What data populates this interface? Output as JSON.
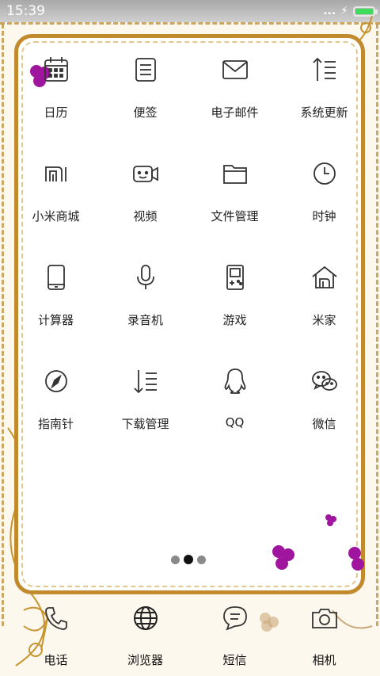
{
  "status_bar": {
    "time": "15:39",
    "signal_dots": "...",
    "charging_symbol": "⚡",
    "battery_color": "#3ddc5a"
  },
  "apps": [
    {
      "label": "日历",
      "icon": "calendar-icon"
    },
    {
      "label": "便签",
      "icon": "notes-icon"
    },
    {
      "label": "电子邮件",
      "icon": "mail-icon"
    },
    {
      "label": "系统更新",
      "icon": "system-update-icon"
    },
    {
      "label": "小米商城",
      "icon": "mi-store-icon"
    },
    {
      "label": "视频",
      "icon": "video-icon"
    },
    {
      "label": "文件管理",
      "icon": "folder-icon"
    },
    {
      "label": "时钟",
      "icon": "clock-icon"
    },
    {
      "label": "计算器",
      "icon": "calculator-icon"
    },
    {
      "label": "录音机",
      "icon": "microphone-icon"
    },
    {
      "label": "游戏",
      "icon": "game-icon"
    },
    {
      "label": "米家",
      "icon": "smart-home-icon"
    },
    {
      "label": "指南针",
      "icon": "compass-icon"
    },
    {
      "label": "下载管理",
      "icon": "download-icon"
    },
    {
      "label": "QQ",
      "icon": "qq-icon"
    },
    {
      "label": "微信",
      "icon": "wechat-icon"
    }
  ],
  "page_indicator": {
    "pages": 3,
    "active_index": 1
  },
  "dock": [
    {
      "label": "电话",
      "icon": "phone-icon"
    },
    {
      "label": "浏览器",
      "icon": "browser-icon"
    },
    {
      "label": "短信",
      "icon": "sms-icon"
    },
    {
      "label": "相机",
      "icon": "camera-icon"
    }
  ],
  "colors": {
    "frame": "#c08a2d",
    "accent_flower": "#a0159e",
    "icon_stroke": "#333333"
  }
}
